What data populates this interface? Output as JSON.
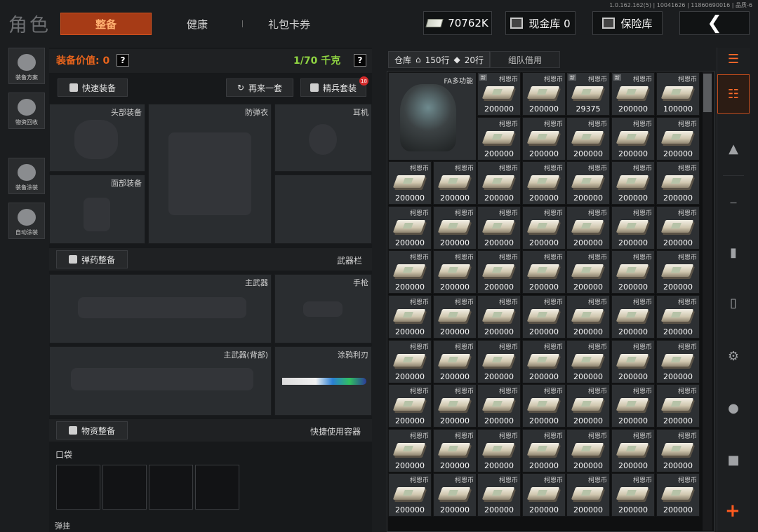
{
  "version": "1.0.162.162(5) | 10041626 | 11860690016 | 品质-6",
  "title": "角色",
  "tabs": {
    "active": "整备",
    "health": "健康",
    "gift": "礼包卡券"
  },
  "top": {
    "money": "70762K",
    "cash_vault": "现金库 0",
    "safe": "保险库"
  },
  "left_nav": {
    "loadout": "装备方案",
    "recycle": "物资回收",
    "paint": "装备涂装",
    "auto_paint": "自动涂装"
  },
  "equip": {
    "value_label": "装备价值: 0",
    "help": "?",
    "weight": "1/70 千克",
    "quick_equip": "快速装备",
    "again": "再来一套",
    "elite": "精兵套装",
    "elite_badge": "18",
    "slots": {
      "head": "头部装备",
      "armor": "防弹衣",
      "ear": "耳机",
      "face": "面部装备",
      "primary": "主武器",
      "pistol": "手枪",
      "primary_back": "主武器(背部)",
      "melee": "涂鸦利刃"
    },
    "ammo": "弹药整备",
    "weapon_bar": "武器栏",
    "supply": "物资整备",
    "quick_container": "快捷使用容器",
    "pocket": "口袋",
    "bottom_cut": "弹挂"
  },
  "warehouse": {
    "tab_label": "仓库",
    "rows": "150行",
    "columns": "20行",
    "team_borrow": "组队借用",
    "bag_name": "FA多功能",
    "item_name": "柯恩币",
    "first_row": [
      "200000",
      "200000",
      "29375",
      "200000",
      "100000"
    ],
    "first_row_new": [
      true,
      false,
      true,
      true,
      false
    ],
    "second_row": [
      "200000",
      "200000",
      "200000",
      "200000",
      "200000"
    ],
    "grid_value": "200000",
    "grid_rows": 8,
    "grid_cols": 7
  }
}
